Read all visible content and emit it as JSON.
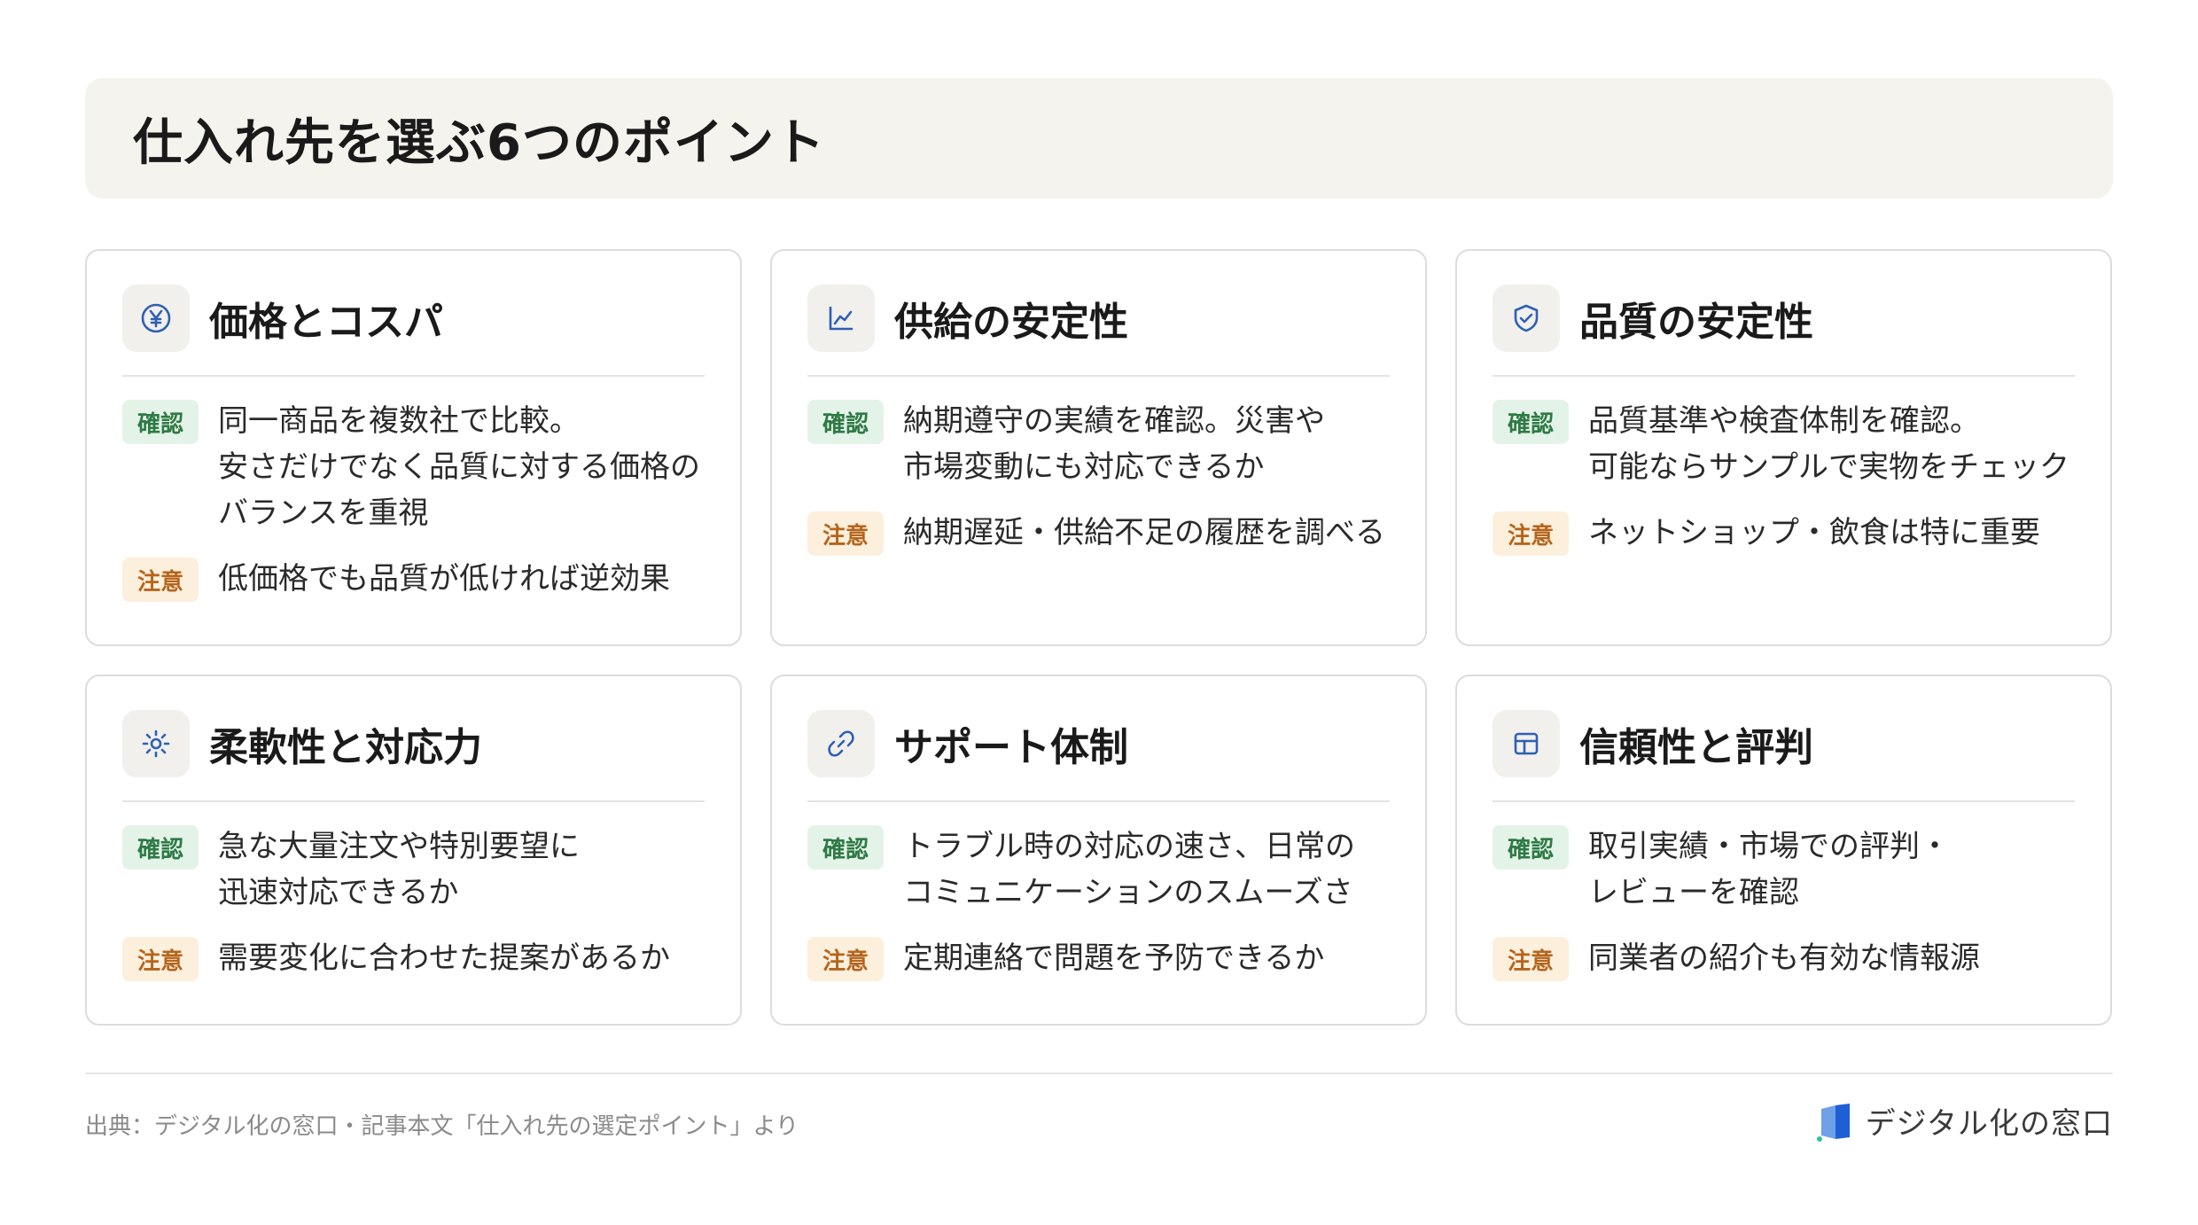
{
  "title": "仕入れ先を選ぶ6つのポイント",
  "cards": [
    {
      "title": "価格とコスパ",
      "icon": "yen-icon",
      "items": [
        {
          "badge": "確認",
          "text": "同一商品を複数社で比較。\n安さだけでなく品質に対する価格の\nバランスを重視"
        },
        {
          "badge": "注意",
          "text": "低価格でも品質が低ければ逆効果"
        }
      ]
    },
    {
      "title": "供給の安定性",
      "icon": "chart-icon",
      "items": [
        {
          "badge": "確認",
          "text": "納期遵守の実績を確認。災害や\n市場変動にも対応できるか"
        },
        {
          "badge": "注意",
          "text": "納期遅延・供給不足の履歴を調べる"
        }
      ]
    },
    {
      "title": "品質の安定性",
      "icon": "shield-check-icon",
      "items": [
        {
          "badge": "確認",
          "text": "品質基準や検査体制を確認。\n可能ならサンプルで実物をチェック"
        },
        {
          "badge": "注意",
          "text": "ネットショップ・飲食は特に重要"
        }
      ]
    },
    {
      "title": "柔軟性と対応力",
      "icon": "sun-icon",
      "items": [
        {
          "badge": "確認",
          "text": "急な大量注文や特別要望に\n迅速対応できるか"
        },
        {
          "badge": "注意",
          "text": "需要変化に合わせた提案があるか"
        }
      ]
    },
    {
      "title": "サポート体制",
      "icon": "link-icon",
      "items": [
        {
          "badge": "確認",
          "text": "トラブル時の対応の速さ、日常の\nコミュニケーションのスムーズさ"
        },
        {
          "badge": "注意",
          "text": "定期連絡で問題を予防できるか"
        }
      ]
    },
    {
      "title": "信頼性と評判",
      "icon": "table-icon",
      "items": [
        {
          "badge": "確認",
          "text": "取引実績・市場での評判・\nレビューを確認"
        },
        {
          "badge": "注意",
          "text": "同業者の紹介も有効な情報源"
        }
      ]
    }
  ],
  "footer": {
    "source": "出典：デジタル化の窓口・記事本文「仕入れ先の選定ポイント」より",
    "logo_text": "デジタル化の窓口"
  },
  "colors": {
    "accent": "#2f5fb3",
    "check_bg": "#e4f3e8",
    "check_fg": "#2e7a45",
    "warn_bg": "#fcefdc",
    "warn_fg": "#b5651d",
    "header_bg": "#f5f3ee"
  }
}
